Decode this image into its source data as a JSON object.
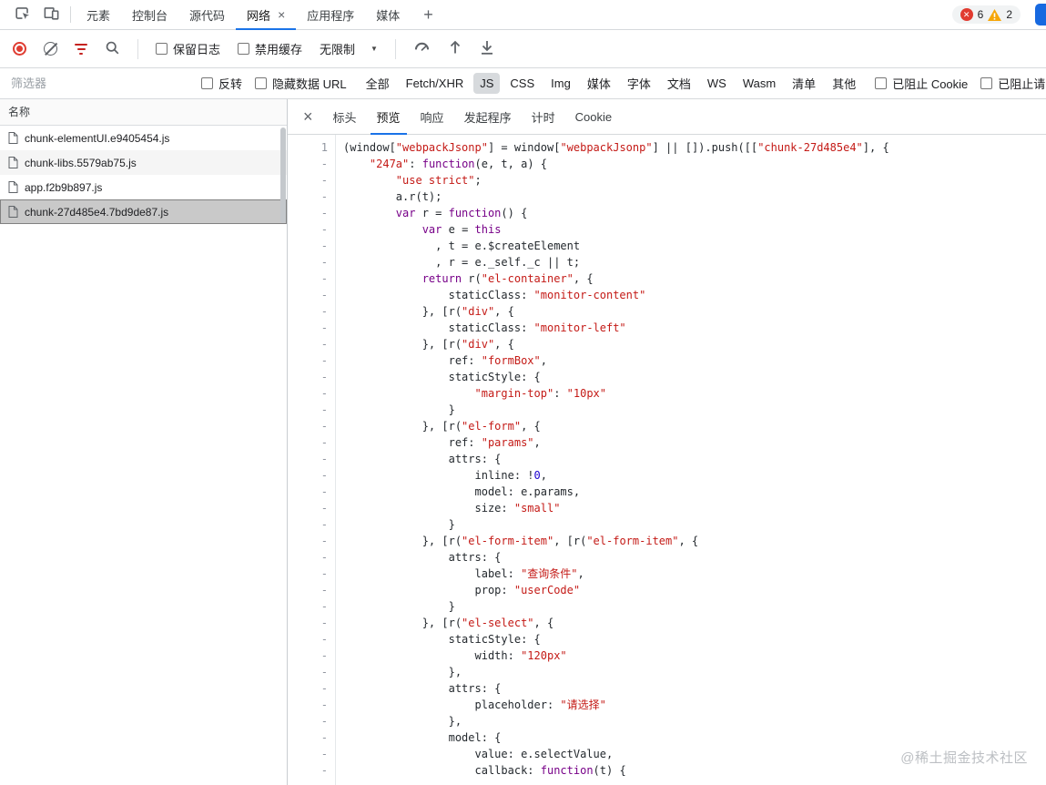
{
  "colors": {
    "accent": "#1a73e8",
    "error": "#e13b30",
    "warning": "#f6a609",
    "string": "#c41a16",
    "keyword": "#770088",
    "number": "#1c00cf"
  },
  "icons": {
    "error_badge_glyph": "✕",
    "dropdown_caret": "▼",
    "close_glyph": "×",
    "more_tabs_glyph": "+"
  },
  "top_bar": {
    "tabs": [
      {
        "id": "elements",
        "label": "元素"
      },
      {
        "id": "console",
        "label": "控制台"
      },
      {
        "id": "sources",
        "label": "源代码"
      },
      {
        "id": "network",
        "label": "网络",
        "active": true,
        "closable": true
      },
      {
        "id": "application",
        "label": "应用程序"
      },
      {
        "id": "media",
        "label": "媒体"
      }
    ],
    "badges": {
      "errors": "6",
      "warnings": "2"
    }
  },
  "toolbar": {
    "preserve_log": "保留日志",
    "disable_cache": "禁用缓存",
    "throttling": "无限制"
  },
  "filter_bar": {
    "placeholder": "筛选器",
    "invert": "反转",
    "hide_data_urls": "隐藏数据 URL",
    "types": [
      "全部",
      "Fetch/XHR",
      "JS",
      "CSS",
      "Img",
      "媒体",
      "字体",
      "文档",
      "WS",
      "Wasm",
      "清单",
      "其他"
    ],
    "active_type": "JS",
    "blocked_cookies": "已阻止 Cookie",
    "blocked_requests": "已阻止请求"
  },
  "requests": {
    "column_header": "名称",
    "rows": [
      "chunk-elementUI.e9405454.js",
      "chunk-libs.5579ab75.js",
      "app.f2b9b897.js",
      "chunk-27d485e4.7bd9de87.js"
    ],
    "selected_index": 3
  },
  "preview": {
    "tabs": [
      "标头",
      "预览",
      "响应",
      "发起程序",
      "计时",
      "Cookie"
    ],
    "active_tab": "预览",
    "lines": [
      {
        "n": "1",
        "t": [
          [
            "p",
            "(window["
          ],
          [
            "s",
            "\"webpackJsonp\""
          ],
          [
            "p",
            "] = window["
          ],
          [
            "s",
            "\"webpackJsonp\""
          ],
          [
            "p",
            "] || []).push([["
          ],
          [
            "s",
            "\"chunk-27d485e4\""
          ],
          [
            "p",
            "], {"
          ]
        ]
      },
      {
        "n": "-",
        "t": [
          [
            "p",
            "    "
          ],
          [
            "s",
            "\"247a\""
          ],
          [
            "p",
            ": "
          ],
          [
            "k",
            "function"
          ],
          [
            "p",
            "(e, t, a) {"
          ]
        ]
      },
      {
        "n": "-",
        "t": [
          [
            "p",
            "        "
          ],
          [
            "s",
            "\"use strict\""
          ],
          [
            "p",
            ";"
          ]
        ]
      },
      {
        "n": "-",
        "t": [
          [
            "p",
            "        a.r(t);"
          ]
        ]
      },
      {
        "n": "-",
        "t": [
          [
            "p",
            "        "
          ],
          [
            "k",
            "var"
          ],
          [
            "p",
            " r = "
          ],
          [
            "k",
            "function"
          ],
          [
            "p",
            "() {"
          ]
        ]
      },
      {
        "n": "-",
        "t": [
          [
            "p",
            "            "
          ],
          [
            "k",
            "var"
          ],
          [
            "p",
            " e = "
          ],
          [
            "k",
            "this"
          ]
        ]
      },
      {
        "n": "-",
        "t": [
          [
            "p",
            "              , t = e.$createElement"
          ]
        ]
      },
      {
        "n": "-",
        "t": [
          [
            "p",
            "              , r = e._self._c || t;"
          ]
        ]
      },
      {
        "n": "-",
        "t": [
          [
            "p",
            "            "
          ],
          [
            "k",
            "return"
          ],
          [
            "p",
            " r("
          ],
          [
            "s",
            "\"el-container\""
          ],
          [
            "p",
            ", {"
          ]
        ]
      },
      {
        "n": "-",
        "t": [
          [
            "p",
            "                staticClass: "
          ],
          [
            "s",
            "\"monitor-content\""
          ]
        ]
      },
      {
        "n": "-",
        "t": [
          [
            "p",
            "            }, [r("
          ],
          [
            "s",
            "\"div\""
          ],
          [
            "p",
            ", {"
          ]
        ]
      },
      {
        "n": "-",
        "t": [
          [
            "p",
            "                staticClass: "
          ],
          [
            "s",
            "\"monitor-left\""
          ]
        ]
      },
      {
        "n": "-",
        "t": [
          [
            "p",
            "            }, [r("
          ],
          [
            "s",
            "\"div\""
          ],
          [
            "p",
            ", {"
          ]
        ]
      },
      {
        "n": "-",
        "t": [
          [
            "p",
            "                ref: "
          ],
          [
            "s",
            "\"formBox\""
          ],
          [
            "p",
            ","
          ]
        ]
      },
      {
        "n": "-",
        "t": [
          [
            "p",
            "                staticStyle: {"
          ]
        ]
      },
      {
        "n": "-",
        "t": [
          [
            "p",
            "                    "
          ],
          [
            "s",
            "\"margin-top\""
          ],
          [
            "p",
            ": "
          ],
          [
            "s",
            "\"10px\""
          ]
        ]
      },
      {
        "n": "-",
        "t": [
          [
            "p",
            "                }"
          ]
        ]
      },
      {
        "n": "-",
        "t": [
          [
            "p",
            "            }, [r("
          ],
          [
            "s",
            "\"el-form\""
          ],
          [
            "p",
            ", {"
          ]
        ]
      },
      {
        "n": "-",
        "t": [
          [
            "p",
            "                ref: "
          ],
          [
            "s",
            "\"params\""
          ],
          [
            "p",
            ","
          ]
        ]
      },
      {
        "n": "-",
        "t": [
          [
            "p",
            "                attrs: {"
          ]
        ]
      },
      {
        "n": "-",
        "t": [
          [
            "p",
            "                    inline: !"
          ],
          [
            "nu",
            "0"
          ],
          [
            "p",
            ","
          ]
        ]
      },
      {
        "n": "-",
        "t": [
          [
            "p",
            "                    model: e.params,"
          ]
        ]
      },
      {
        "n": "-",
        "t": [
          [
            "p",
            "                    size: "
          ],
          [
            "s",
            "\"small\""
          ]
        ]
      },
      {
        "n": "-",
        "t": [
          [
            "p",
            "                }"
          ]
        ]
      },
      {
        "n": "-",
        "t": [
          [
            "p",
            "            }, [r("
          ],
          [
            "s",
            "\"el-form-item\""
          ],
          [
            "p",
            ", [r("
          ],
          [
            "s",
            "\"el-form-item\""
          ],
          [
            "p",
            ", {"
          ]
        ]
      },
      {
        "n": "-",
        "t": [
          [
            "p",
            "                attrs: {"
          ]
        ]
      },
      {
        "n": "-",
        "t": [
          [
            "p",
            "                    label: "
          ],
          [
            "s",
            "\"查询条件\""
          ],
          [
            "p",
            ","
          ]
        ]
      },
      {
        "n": "-",
        "t": [
          [
            "p",
            "                    prop: "
          ],
          [
            "s",
            "\"userCode\""
          ]
        ]
      },
      {
        "n": "-",
        "t": [
          [
            "p",
            "                }"
          ]
        ]
      },
      {
        "n": "-",
        "t": [
          [
            "p",
            "            }, [r("
          ],
          [
            "s",
            "\"el-select\""
          ],
          [
            "p",
            ", {"
          ]
        ]
      },
      {
        "n": "-",
        "t": [
          [
            "p",
            "                staticStyle: {"
          ]
        ]
      },
      {
        "n": "-",
        "t": [
          [
            "p",
            "                    width: "
          ],
          [
            "s",
            "\"120px\""
          ]
        ]
      },
      {
        "n": "-",
        "t": [
          [
            "p",
            "                },"
          ]
        ]
      },
      {
        "n": "-",
        "t": [
          [
            "p",
            "                attrs: {"
          ]
        ]
      },
      {
        "n": "-",
        "t": [
          [
            "p",
            "                    placeholder: "
          ],
          [
            "s",
            "\"请选择\""
          ]
        ]
      },
      {
        "n": "-",
        "t": [
          [
            "p",
            "                },"
          ]
        ]
      },
      {
        "n": "-",
        "t": [
          [
            "p",
            "                model: {"
          ]
        ]
      },
      {
        "n": "-",
        "t": [
          [
            "p",
            "                    value: e.selectValue,"
          ]
        ]
      },
      {
        "n": "-",
        "t": [
          [
            "p",
            "                    callback: "
          ],
          [
            "k",
            "function"
          ],
          [
            "p",
            "(t) {"
          ]
        ]
      }
    ]
  },
  "watermark": "@稀土掘金技术社区"
}
